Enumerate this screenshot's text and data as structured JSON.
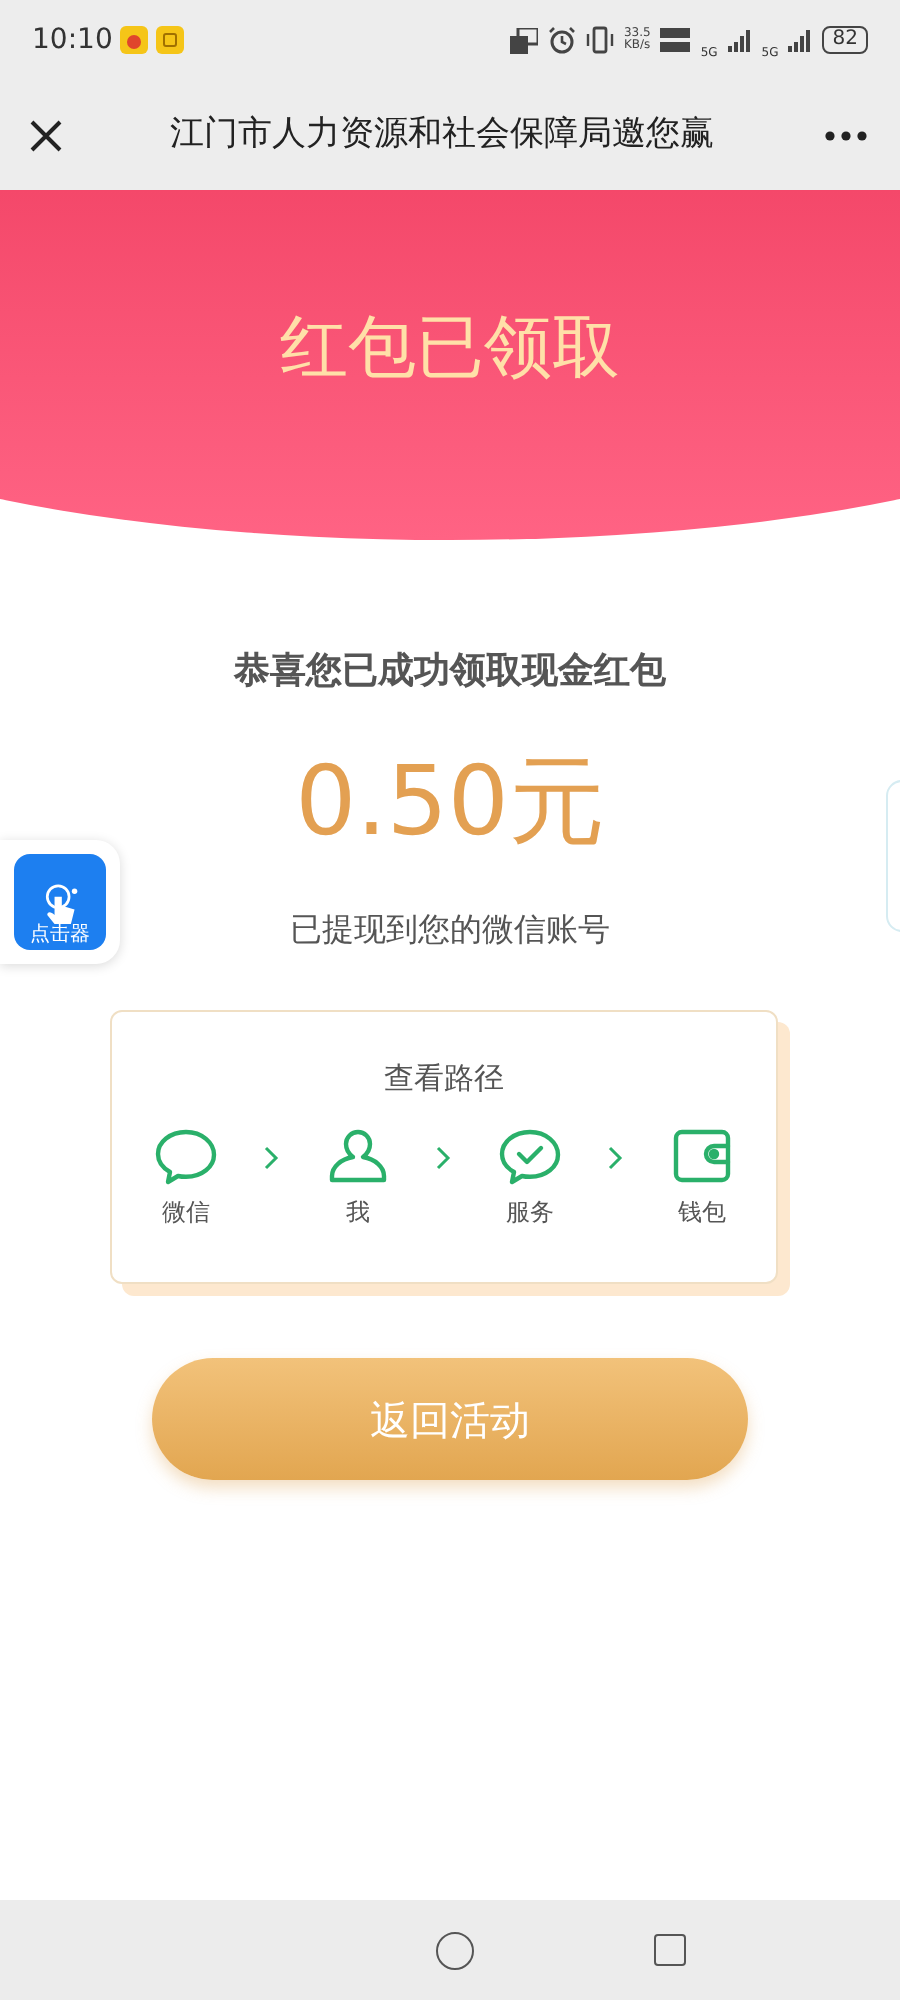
{
  "status_bar": {
    "time": "10:10",
    "net_speed": "33.5",
    "net_unit": "KB/s",
    "sim_1": "5G",
    "sim_2": "5G",
    "battery": "82"
  },
  "header": {
    "title": "江门市人力资源和社会保障局邀您赢"
  },
  "banner": {
    "title": "红包已领取"
  },
  "result": {
    "headline": "恭喜您已成功领取现金红包",
    "amount": "0.50元",
    "note": "已提现到您的微信账号"
  },
  "floating_widget": {
    "label": "点击器"
  },
  "path_card": {
    "title": "查看路径",
    "steps": [
      {
        "kind": "chat",
        "label": "微信"
      },
      {
        "kind": "person",
        "label": "我"
      },
      {
        "kind": "service",
        "label": "服务"
      },
      {
        "kind": "wallet",
        "label": "钱包"
      }
    ]
  },
  "back_button": {
    "label": "返回活动"
  }
}
